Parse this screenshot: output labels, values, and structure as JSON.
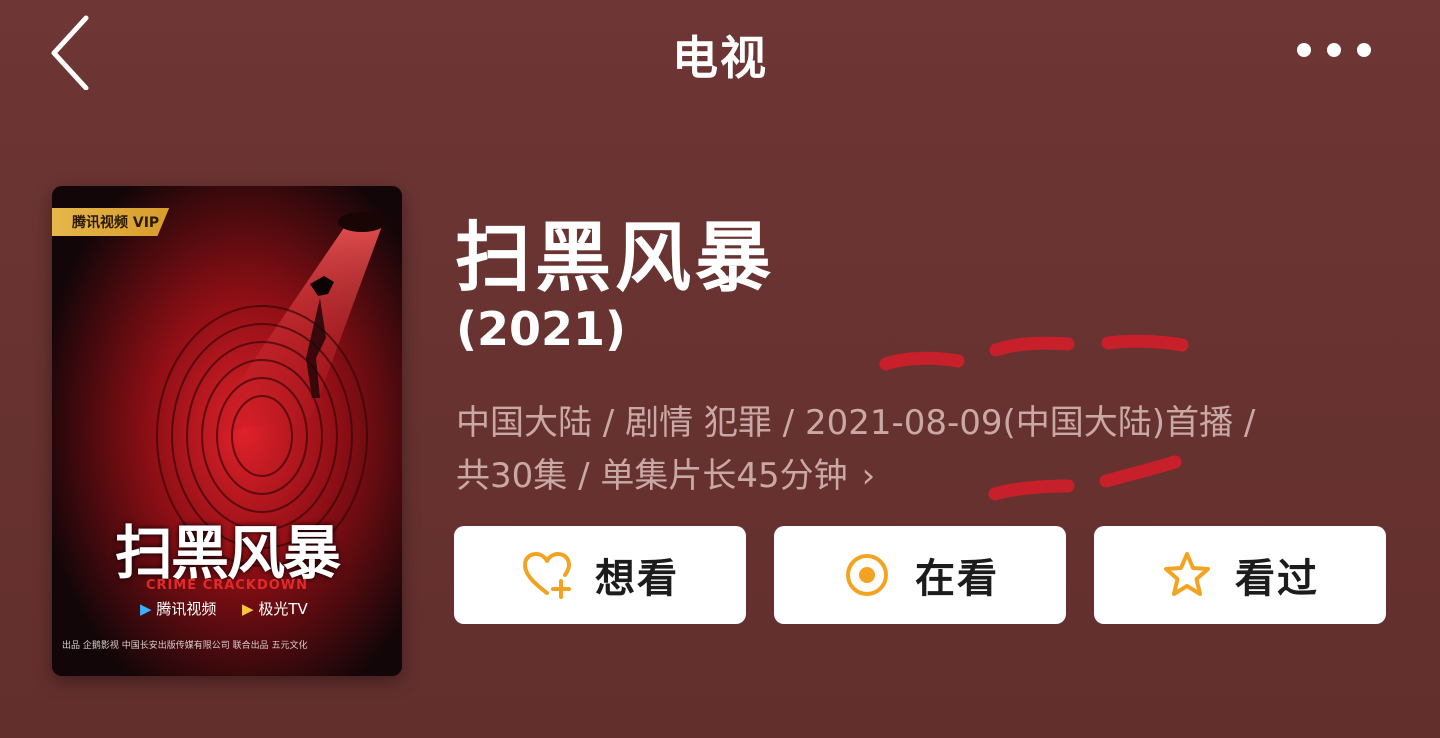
{
  "header": {
    "title": "电视",
    "back_icon": "chevron-left-icon",
    "more_icon": "more-dots-icon"
  },
  "poster": {
    "badge": "腾讯视频 VIP",
    "art_title": "扫黑风暴",
    "art_subtitle": "CRIME CRACKDOWN",
    "logo_left": "腾讯视频",
    "logo_right": "极光TV",
    "credits": "出品  企鹅影视   中国长安出版传媒有限公司   联合出品   五元文化"
  },
  "show": {
    "title": "扫黑风暴",
    "year": "(2021)",
    "meta_line1": "中国大陆 / 剧情 犯罪 / 2021-08-09(中国大陆)首播 /",
    "meta_line2": "共30集 / 单集片长45分钟",
    "meta_chevron": "›"
  },
  "actions": {
    "want": {
      "label": "想看",
      "icon": "heart-plus-icon"
    },
    "watching": {
      "label": "在看",
      "icon": "target-circle-icon"
    },
    "watched": {
      "label": "看过",
      "icon": "star-icon"
    }
  },
  "colors": {
    "background": "#6b3432",
    "accent": "#f3a321",
    "meta_text": "#c9a9a6",
    "scribble": "#c8202b"
  }
}
